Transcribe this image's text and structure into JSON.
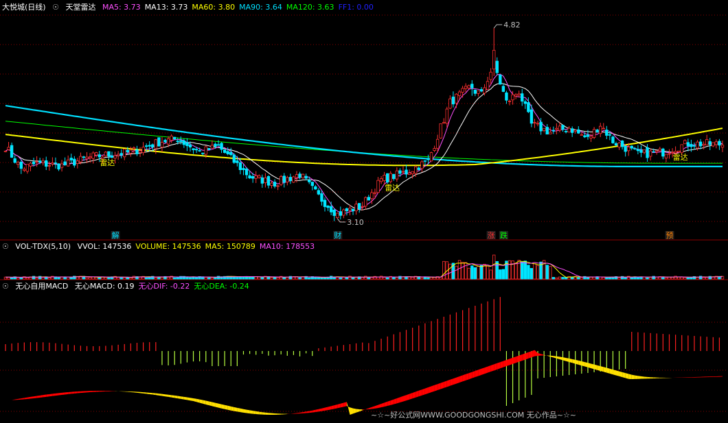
{
  "colors": {
    "bg": "#000000",
    "up": "#ff3030",
    "down": "#00e5ff",
    "grid": "#8b0000",
    "ma5": "#ff50ff",
    "ma13": "#ffffff",
    "ma60": "#ffff00",
    "ma90": "#00e0ff",
    "ma120": "#00ff00",
    "ff1": "#2020ff",
    "macd_up": "#ff2020",
    "macd_down": "#b8ff40",
    "band_up": "#ff0000",
    "band_down": "#ffe000"
  },
  "panels": {
    "main": {
      "stock_name": "大悦城(日线)",
      "indicator": "天堂雷达",
      "ma": [
        {
          "label": "MA5:",
          "value": "3.73",
          "color": "#ff50ff"
        },
        {
          "label": "MA13:",
          "value": "3.73",
          "color": "#ffffff"
        },
        {
          "label": "MA60:",
          "value": "3.80",
          "color": "#ffff00"
        },
        {
          "label": "MA90:",
          "value": "3.64",
          "color": "#00e0ff"
        },
        {
          "label": "MA120:",
          "value": "3.63",
          "color": "#00ff00"
        },
        {
          "label": "FF1:",
          "value": "0.00",
          "color": "#2020ff"
        }
      ],
      "annotations": {
        "high": "4.82",
        "low": "3.10",
        "radar": "雷达"
      },
      "events": [
        {
          "label": "解",
          "i": 35,
          "color": "#00e0ff"
        },
        {
          "label": "财",
          "i": 106,
          "color": "#00e0ff"
        },
        {
          "label": "涨",
          "i": 155,
          "color": "#ff3030"
        },
        {
          "label": "跌",
          "i": 159,
          "color": "#00ff00"
        },
        {
          "label": "预",
          "i": 212,
          "color": "#ff8000"
        }
      ]
    },
    "volume": {
      "name": "VOL-TDX(5,10)",
      "items": [
        {
          "label": "VVOL:",
          "value": "147536",
          "color": "#ffffff"
        },
        {
          "label": "VOLUME:",
          "value": "147536",
          "color": "#ffff00"
        },
        {
          "label": "MA5:",
          "value": "150789",
          "color": "#ffff00"
        },
        {
          "label": "MA10:",
          "value": "178553",
          "color": "#ff50ff"
        }
      ]
    },
    "macd": {
      "name": "无心自用MACD",
      "items": [
        {
          "label": "无心MACD:",
          "value": "0.19",
          "color": "#ffffff"
        },
        {
          "label": "无心DIF:",
          "value": "-0.22",
          "color": "#ff50ff"
        },
        {
          "label": "无心DEA:",
          "value": "-0.24",
          "color": "#00ff00"
        }
      ],
      "watermark": "~☆~好公式网WWW.GOODGONGSHI.COM 无心作品~☆~"
    }
  },
  "chart_data": {
    "type": "candlestick",
    "bars": 230,
    "ylim": [
      3.0,
      4.95
    ],
    "anchors": [
      [
        0,
        3.75
      ],
      [
        5,
        3.55
      ],
      [
        10,
        3.6
      ],
      [
        18,
        3.58
      ],
      [
        28,
        3.66
      ],
      [
        40,
        3.7
      ],
      [
        50,
        3.8
      ],
      [
        55,
        3.82
      ],
      [
        62,
        3.7
      ],
      [
        68,
        3.75
      ],
      [
        78,
        3.48
      ],
      [
        86,
        3.42
      ],
      [
        94,
        3.5
      ],
      [
        100,
        3.3
      ],
      [
        106,
        3.14
      ],
      [
        114,
        3.22
      ],
      [
        120,
        3.45
      ],
      [
        128,
        3.52
      ],
      [
        135,
        3.62
      ],
      [
        142,
        4.15
      ],
      [
        148,
        4.28
      ],
      [
        152,
        4.22
      ],
      [
        156,
        4.5
      ],
      [
        160,
        4.15
      ],
      [
        164,
        4.25
      ],
      [
        168,
        3.95
      ],
      [
        174,
        3.88
      ],
      [
        180,
        3.92
      ],
      [
        186,
        3.82
      ],
      [
        190,
        3.95
      ],
      [
        194,
        3.8
      ],
      [
        202,
        3.68
      ],
      [
        210,
        3.7
      ],
      [
        218,
        3.78
      ],
      [
        229,
        3.77
      ]
    ]
  }
}
